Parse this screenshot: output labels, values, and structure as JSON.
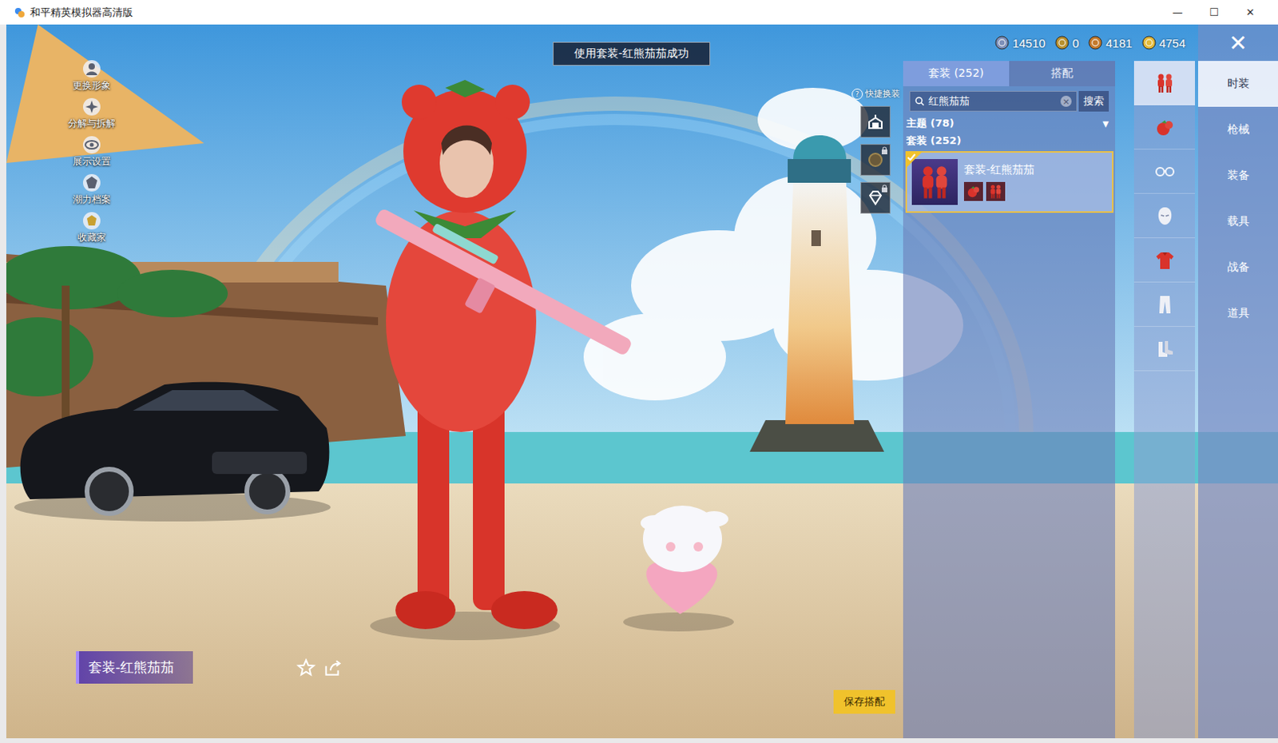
{
  "window": {
    "title": "和平精英模拟器高清版",
    "controls": [
      "—",
      "☐",
      "✕"
    ]
  },
  "side_menu": [
    {
      "label": "更换形象",
      "kind": "avatar"
    },
    {
      "label": "分解与拆解",
      "kind": "decompose"
    },
    {
      "label": "展示设置",
      "kind": "display"
    },
    {
      "label": "潮力档案",
      "kind": "profile"
    },
    {
      "label": "收藏家",
      "kind": "collector"
    }
  ],
  "toast": "使用套装-红熊茄茄成功",
  "currencies": [
    {
      "amount": "14510",
      "color": "#7d8fb8"
    },
    {
      "amount": "0",
      "color": "#b8902e"
    },
    {
      "amount": "4181",
      "color": "#c47a2c"
    },
    {
      "amount": "4754",
      "color": "#e2b93a"
    }
  ],
  "close": "✕",
  "quick_change": {
    "label": "快捷换装",
    "help": "?",
    "buttons": [
      {
        "kind": "wardrobe",
        "locked": false
      },
      {
        "kind": "badge",
        "locked": true
      },
      {
        "kind": "gem",
        "locked": true
      }
    ]
  },
  "panel": {
    "tabs": [
      {
        "label": "套装 (252)",
        "selected": true
      },
      {
        "label": "搭配",
        "selected": false
      }
    ],
    "search": {
      "value": "红熊茄茄",
      "clear": "×",
      "button": "搜索"
    },
    "filter": {
      "label": "主题 (78)",
      "arrow": "▼",
      "expanded": false
    },
    "section": "套装 (252)",
    "items": [
      {
        "name": "套装-红熊茄茄",
        "selected": true,
        "equipped": true,
        "parts": [
          {
            "kind": "hat"
          },
          {
            "kind": "suit"
          }
        ]
      }
    ]
  },
  "categories": [
    {
      "kind": "suit",
      "selected": true
    },
    {
      "kind": "hat",
      "selected": false
    },
    {
      "kind": "glasses",
      "selected": false
    },
    {
      "kind": "mask",
      "selected": false
    },
    {
      "kind": "top",
      "selected": false
    },
    {
      "kind": "pants",
      "selected": false
    },
    {
      "kind": "shoes",
      "selected": false
    }
  ],
  "nav": [
    {
      "label": "时装",
      "selected": true
    },
    {
      "label": "枪械",
      "selected": false
    },
    {
      "label": "装备",
      "selected": false
    },
    {
      "label": "载具",
      "selected": false
    },
    {
      "label": "战备",
      "selected": false
    },
    {
      "label": "道具",
      "selected": false
    }
  ],
  "name_plate": {
    "title": "套装-红熊茄茄",
    "favorited": false
  },
  "save_button": "保存搭配"
}
